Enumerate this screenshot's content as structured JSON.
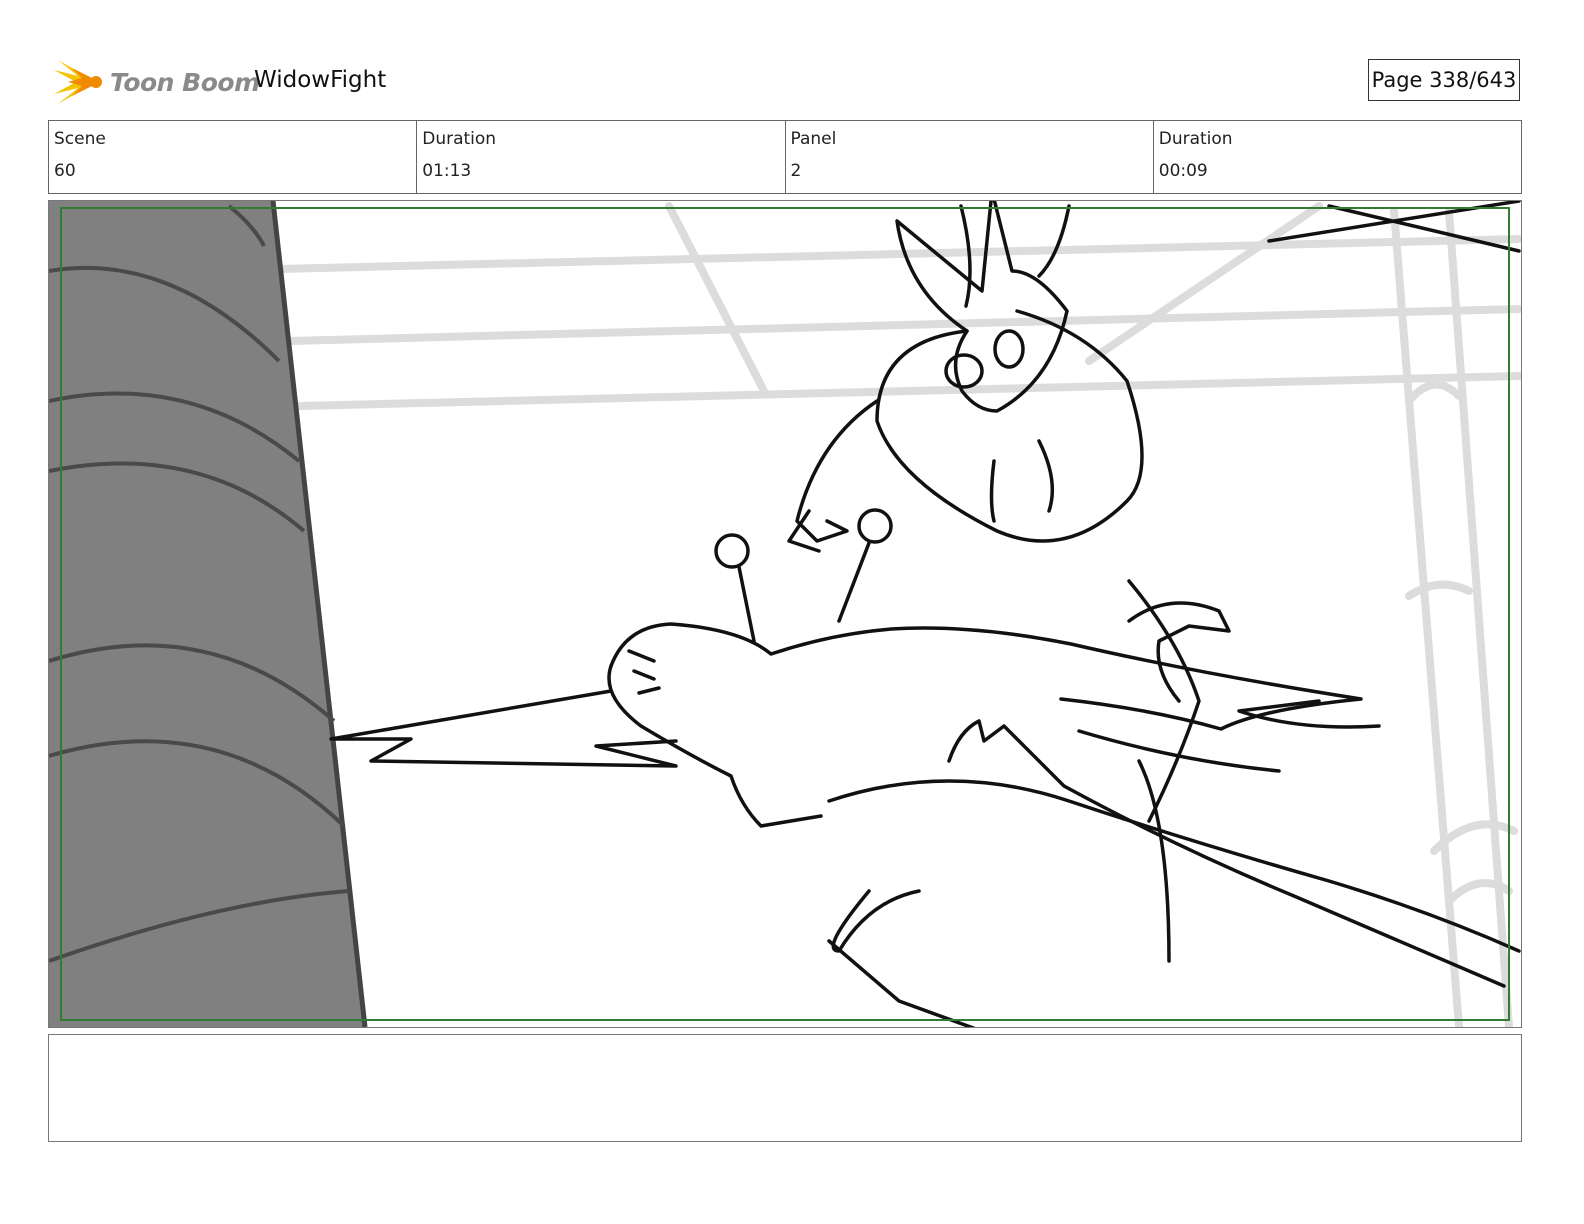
{
  "header": {
    "logo_text": "Toon Boom",
    "logo_icon": "toon-boom-starburst-icon",
    "project_title": "WidowFight",
    "page_label": "Page 338/643"
  },
  "info": {
    "scene_label": "Scene",
    "scene_value": "60",
    "scene_duration_label": "Duration",
    "scene_duration_value": "01:13",
    "panel_label": "Panel",
    "panel_value": "2",
    "panel_duration_label": "Duration",
    "panel_duration_value": "00:09"
  },
  "colors": {
    "logo_yellow": "#f5c400",
    "logo_orange": "#f08a00",
    "safe_frame_green": "#2e7d32",
    "pillar_gray": "#808080",
    "background_lines": "#d9d9d9"
  },
  "notes": {
    "text": ""
  }
}
